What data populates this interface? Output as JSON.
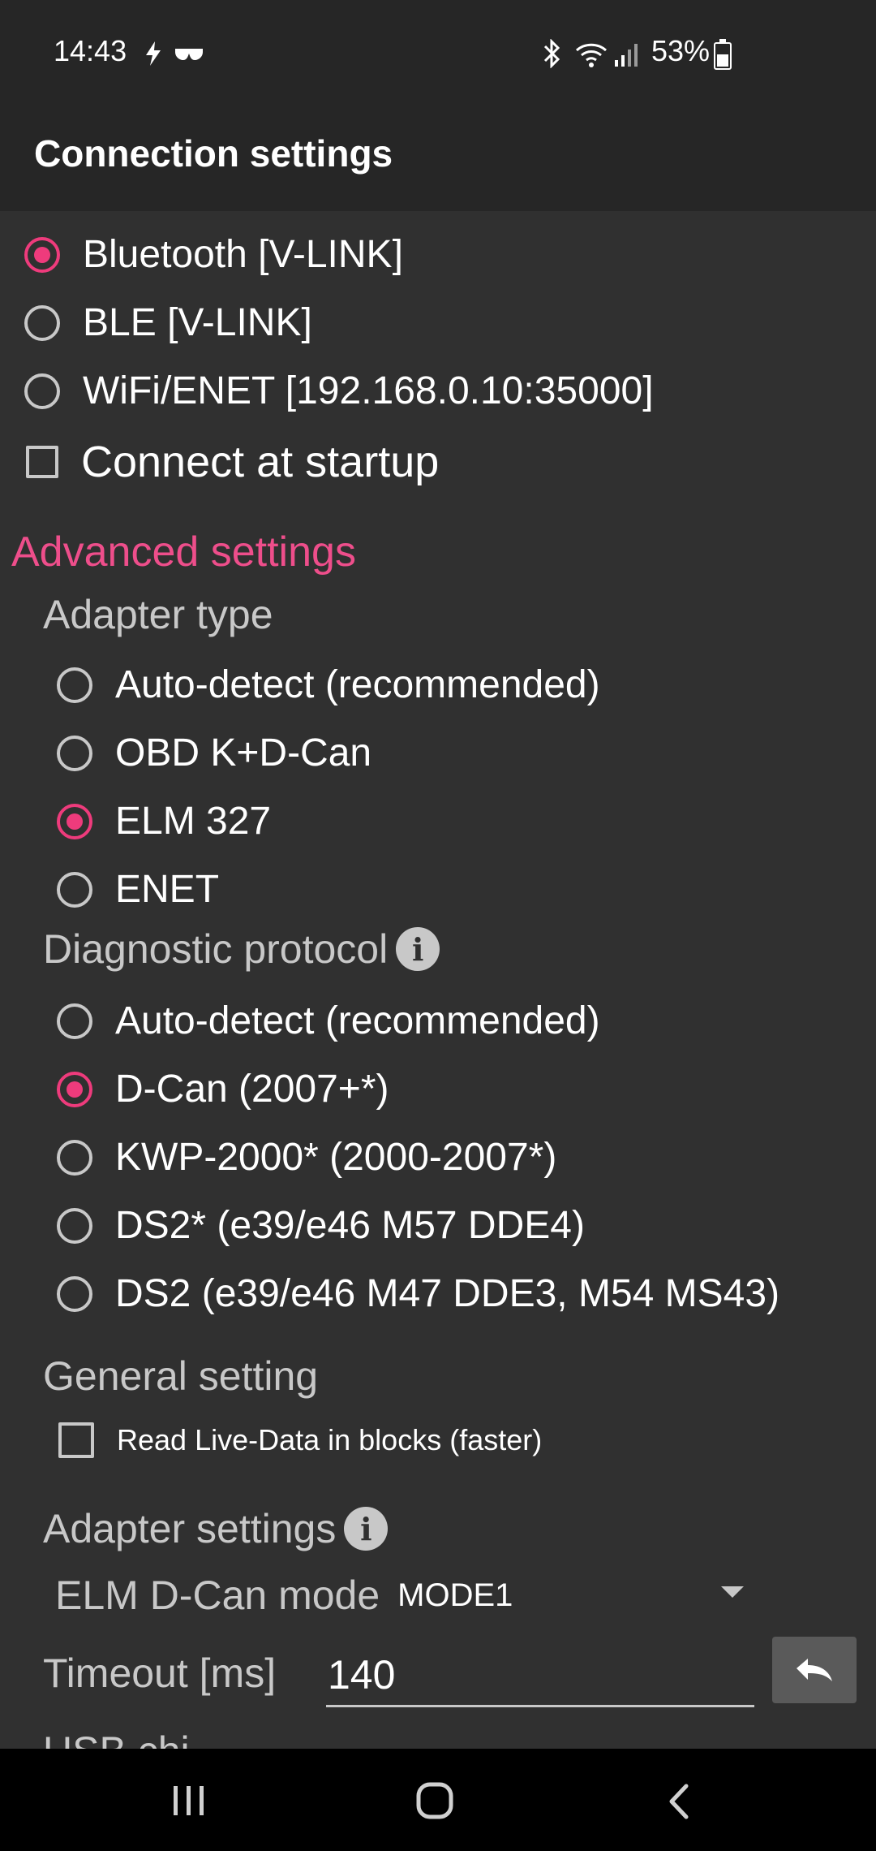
{
  "status_bar": {
    "time": "14:43",
    "left_icons": [
      "bolt-icon",
      "glasses-icon"
    ],
    "right_icons": [
      "bluetooth-icon",
      "wifi-icon",
      "signal-icon"
    ],
    "battery_percent": "53%",
    "battery_level": 0.53
  },
  "app_bar": {
    "title": "Connection settings"
  },
  "connection": {
    "options": [
      {
        "label": "Bluetooth [V-LINK]",
        "checked": true
      },
      {
        "label": "BLE [V-LINK]",
        "checked": false
      },
      {
        "label": "WiFi/ENET [192.168.0.10:35000]",
        "checked": false
      }
    ],
    "connect_at_startup": {
      "label": "Connect at startup",
      "checked": false
    }
  },
  "advanced": {
    "title": "Advanced settings",
    "adapter_type": {
      "title": "Adapter type",
      "options": [
        {
          "label": "Auto-detect (recommended)",
          "checked": false
        },
        {
          "label": "OBD K+D-Can",
          "checked": false
        },
        {
          "label": "ELM 327",
          "checked": true
        },
        {
          "label": "ENET",
          "checked": false
        }
      ]
    },
    "diagnostic_protocol": {
      "title": "Diagnostic protocol",
      "options": [
        {
          "label": "Auto-detect (recommended)",
          "checked": false
        },
        {
          "label": "D-Can (2007+*)",
          "checked": true
        },
        {
          "label": "KWP-2000* (2000-2007*)",
          "checked": false
        },
        {
          "label": "DS2* (e39/e46 M57 DDE4)",
          "checked": false
        },
        {
          "label": "DS2 (e39/e46 M47 DDE3, M54 MS43)",
          "checked": false
        }
      ]
    },
    "general_setting": {
      "title": "General setting",
      "read_live_data": {
        "label": "Read Live-Data in blocks (faster)",
        "checked": false
      }
    },
    "adapter_settings": {
      "title": "Adapter settings",
      "elm_dcan_mode": {
        "label": "ELM D-Can mode",
        "value": "MODE1"
      },
      "timeout": {
        "label": "Timeout [ms]",
        "value": "140"
      },
      "next_label_partial": "USB chi..."
    }
  },
  "colors": {
    "accent": "#ee3b7c",
    "section_title": "#ee4e8b",
    "background": "#303030",
    "bar": "#262626"
  },
  "nav_bar": {
    "buttons": [
      "recent-apps-icon",
      "home-icon",
      "back-icon"
    ]
  }
}
